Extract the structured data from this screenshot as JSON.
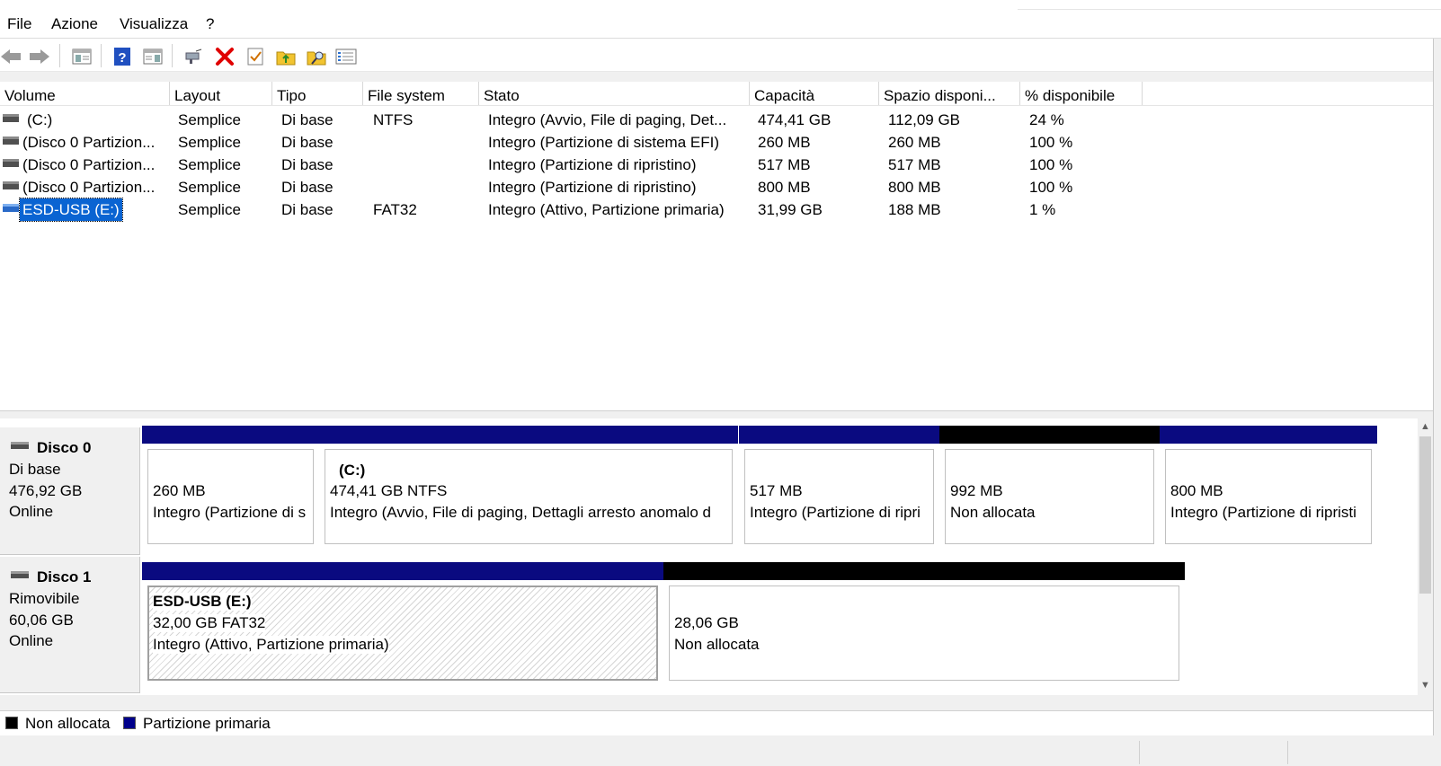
{
  "menu": {
    "items": [
      "File",
      "Azione",
      "Visualizza",
      "?"
    ]
  },
  "toolbar": {
    "buttons": [
      "back-icon",
      "forward-icon",
      "show-hide-console-tree-icon",
      "help-icon",
      "show-action-pane-icon",
      "connect-icon",
      "delete-icon",
      "properties-icon",
      "up-folder-icon",
      "search-icon",
      "list-view-icon"
    ],
    "colors": {
      "delete": "#e00000",
      "help": "#2050c0",
      "folder": "#f2c430"
    }
  },
  "volume_list": {
    "columns": [
      "Volume",
      "Layout",
      "Tipo",
      "File system",
      "Stato",
      "Capacità",
      "Spazio disponi...",
      "% disponibile"
    ],
    "rows": [
      {
        "volume": "(C:)",
        "layout": "Semplice",
        "tipo": "Di base",
        "fs": "NTFS",
        "stato": "Integro (Avvio, File di paging, Det...",
        "capacita": "474,41 GB",
        "spazio": "112,09 GB",
        "perc": "24 %"
      },
      {
        "volume": "(Disco 0 Partizion...",
        "layout": "Semplice",
        "tipo": "Di base",
        "fs": "",
        "stato": "Integro (Partizione di sistema EFI)",
        "capacita": "260 MB",
        "spazio": "260 MB",
        "perc": "100 %"
      },
      {
        "volume": "(Disco 0 Partizion...",
        "layout": "Semplice",
        "tipo": "Di base",
        "fs": "",
        "stato": "Integro (Partizione di ripristino)",
        "capacita": "517 MB",
        "spazio": "517 MB",
        "perc": "100 %"
      },
      {
        "volume": "(Disco 0 Partizion...",
        "layout": "Semplice",
        "tipo": "Di base",
        "fs": "",
        "stato": "Integro (Partizione di ripristino)",
        "capacita": "800 MB",
        "spazio": "800 MB",
        "perc": "100 %"
      },
      {
        "volume": "ESD-USB (E:)",
        "layout": "Semplice",
        "tipo": "Di base",
        "fs": "FAT32",
        "stato": "Integro (Attivo, Partizione primaria)",
        "capacita": "31,99 GB",
        "spazio": "188 MB",
        "perc": "1 %"
      }
    ],
    "selected_row": 4
  },
  "disks": [
    {
      "title": "Disco 0",
      "type": "Di base",
      "size": "476,92 GB",
      "status": "Online",
      "partitions": [
        {
          "label": "",
          "line1": "260 MB",
          "line2": "Integro (Partizione di s",
          "kind": "primary"
        },
        {
          "label": "(C:)",
          "line1": "474,41 GB NTFS",
          "line2": "Integro (Avvio, File di paging, Dettagli arresto anomalo d",
          "kind": "primary"
        },
        {
          "label": "",
          "line1": "517 MB",
          "line2": "Integro (Partizione di ripri",
          "kind": "primary"
        },
        {
          "label": "",
          "line1": "992 MB",
          "line2": "Non allocata",
          "kind": "unallocated"
        },
        {
          "label": "",
          "line1": "800 MB",
          "line2": "Integro (Partizione di ripristi",
          "kind": "primary"
        }
      ]
    },
    {
      "title": "Disco 1",
      "type": "Rimovibile",
      "size": "60,06 GB",
      "status": "Online",
      "partitions": [
        {
          "label": "ESD-USB  (E:)",
          "line1": "32,00 GB FAT32",
          "line2": "Integro (Attivo, Partizione primaria)",
          "kind": "primary",
          "selected": true
        },
        {
          "label": "",
          "line1": "28,06 GB",
          "line2": "Non allocata",
          "kind": "unallocated"
        }
      ]
    }
  ],
  "legend": {
    "items": [
      {
        "label": "Non allocata",
        "color": "#000000"
      },
      {
        "label": "Partizione primaria",
        "color": "#00008b"
      }
    ]
  },
  "colors": {
    "primary": "#0a0a80",
    "unallocated": "#000000",
    "selection": "#0a64d2"
  }
}
